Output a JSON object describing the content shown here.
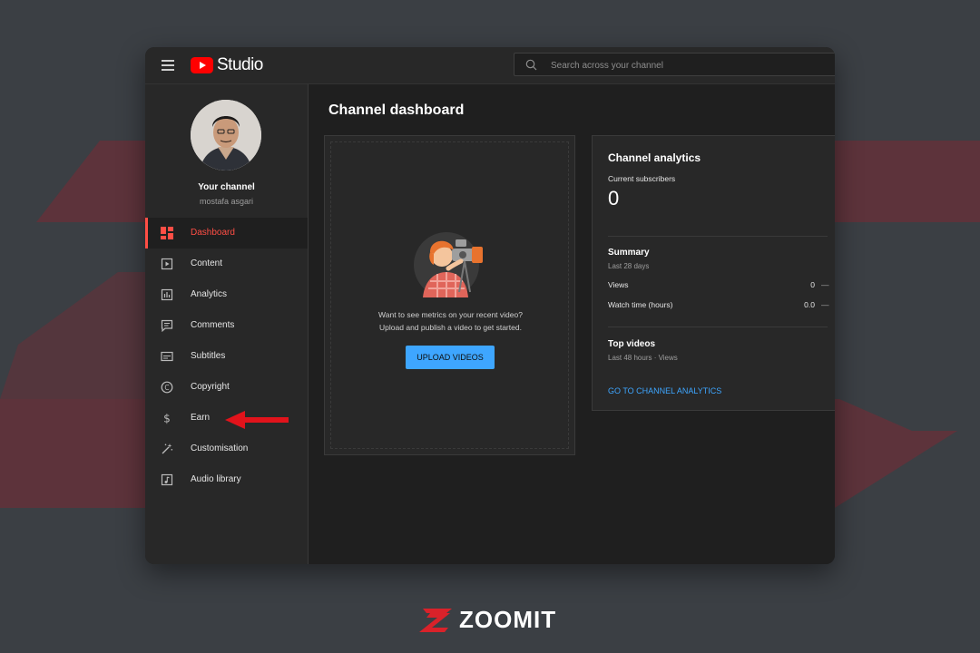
{
  "app": {
    "title": "Studio"
  },
  "search": {
    "placeholder": "Search across your channel"
  },
  "channel": {
    "title": "Your channel",
    "name": "mostafa asgari"
  },
  "sidebar": {
    "items": [
      {
        "label": "Dashboard",
        "icon": "dashboard-icon",
        "active": true
      },
      {
        "label": "Content",
        "icon": "content-icon"
      },
      {
        "label": "Analytics",
        "icon": "analytics-icon"
      },
      {
        "label": "Comments",
        "icon": "comments-icon"
      },
      {
        "label": "Subtitles",
        "icon": "subtitles-icon"
      },
      {
        "label": "Copyright",
        "icon": "copyright-icon"
      },
      {
        "label": "Earn",
        "icon": "earn-icon"
      },
      {
        "label": "Customisation",
        "icon": "customisation-icon"
      },
      {
        "label": "Audio library",
        "icon": "audio-library-icon"
      }
    ]
  },
  "main": {
    "title": "Channel dashboard",
    "upload_card": {
      "line1": "Want to see metrics on your recent video?",
      "line2": "Upload and publish a video to get started.",
      "button": "UPLOAD VIDEOS"
    },
    "analytics_card": {
      "title": "Channel analytics",
      "subscribers_label": "Current subscribers",
      "subscribers_value": "0",
      "summary_title": "Summary",
      "summary_period": "Last 28 days",
      "rows": [
        {
          "label": "Views",
          "value": "0",
          "trend": "—"
        },
        {
          "label": "Watch time (hours)",
          "value": "0.0",
          "trend": "—"
        }
      ],
      "top_videos_title": "Top videos",
      "top_videos_period": "Last 48 hours · Views",
      "link": "GO TO CHANNEL ANALYTICS"
    }
  },
  "watermark": {
    "brand": "ZOOMIT"
  },
  "colors": {
    "accent": "#ff4e45",
    "link": "#3ea6ff",
    "background": "#3b3f44",
    "arrow": "#e1131b"
  }
}
